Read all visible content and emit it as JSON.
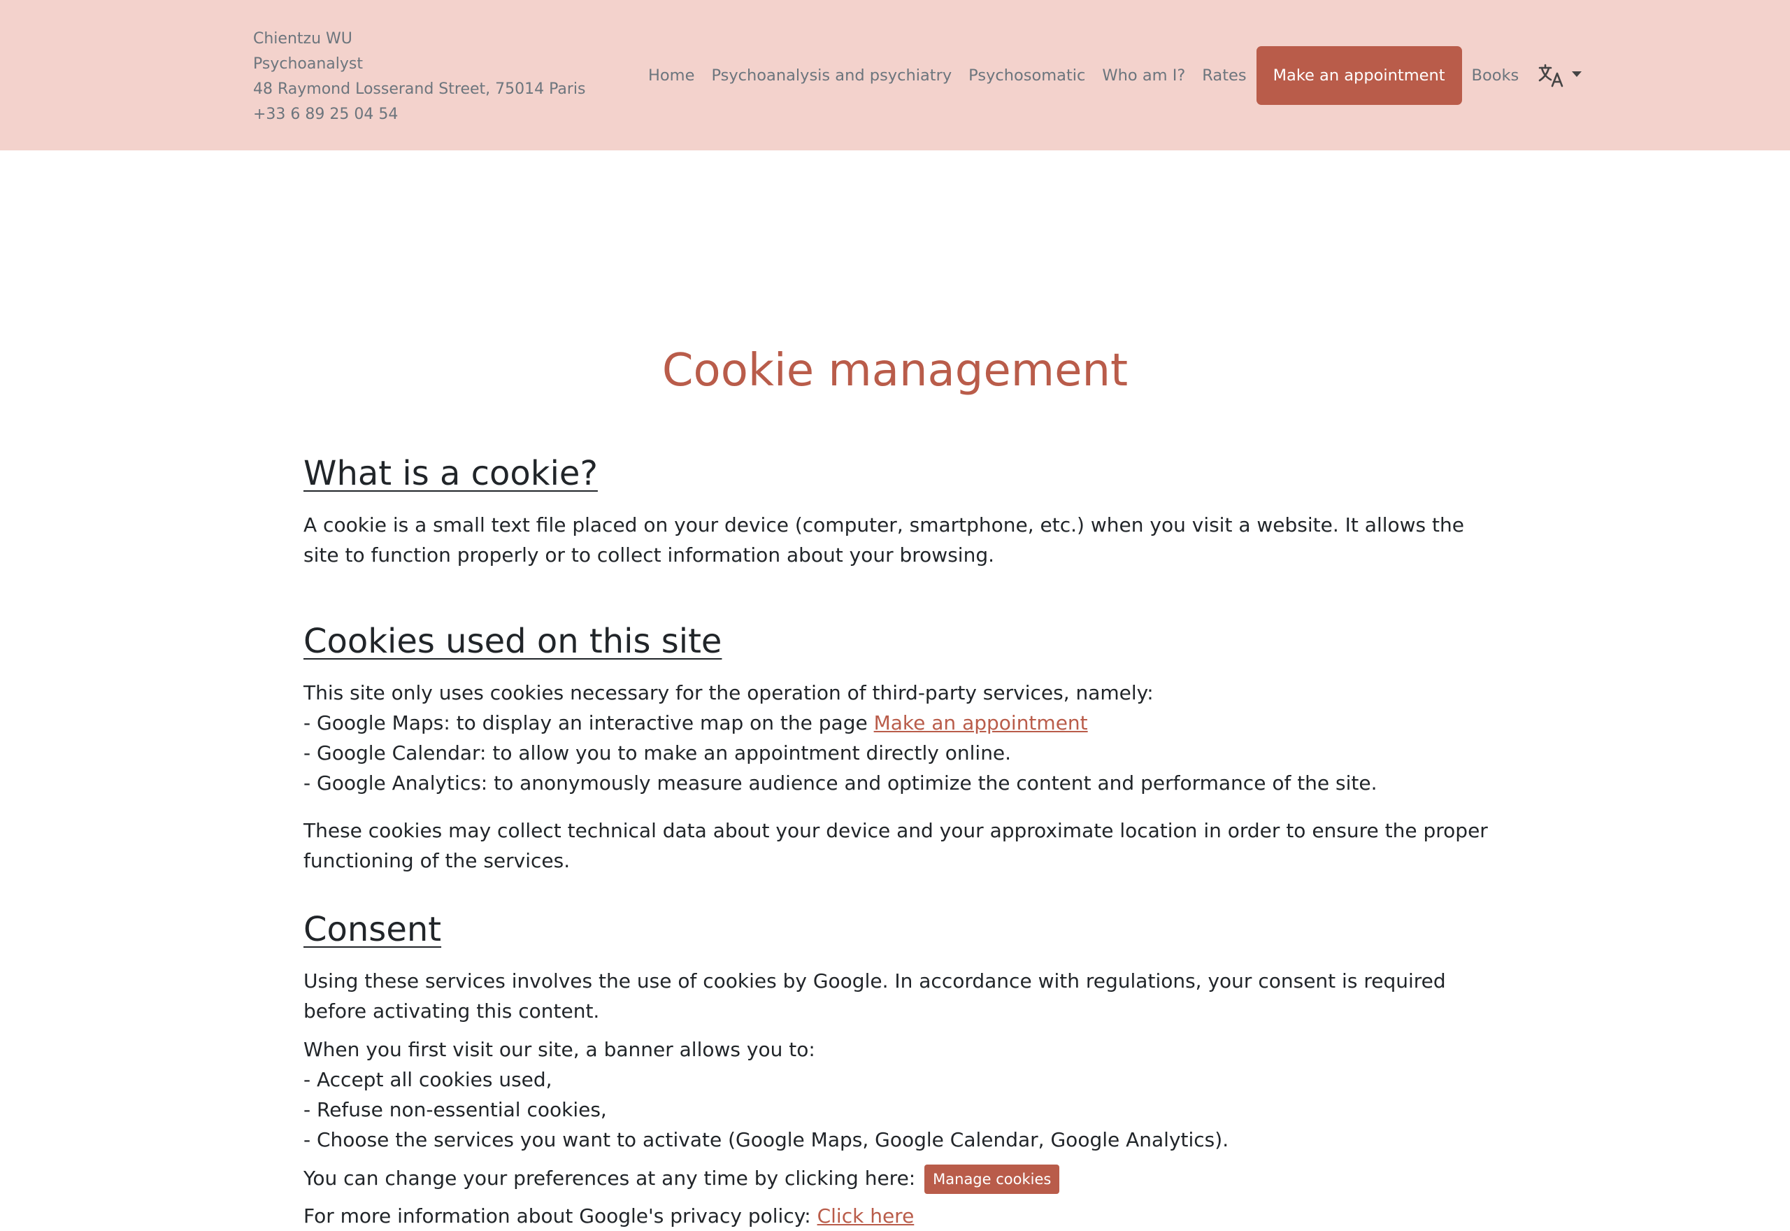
{
  "header": {
    "contact": {
      "name": "Chientzu WU",
      "role": "Psychoanalyst",
      "address": "48 Raymond Losserand Street, 75014 Paris",
      "phone": "+33 6 89 25 04 54"
    },
    "nav": {
      "home": "Home",
      "psychoanalysis": "Psychoanalysis and psychiatry",
      "psychosomatic": "Psychosomatic",
      "who": "Who am I?",
      "rates": "Rates",
      "appointment": "Make an appointment",
      "books": "Books",
      "language_icon": "translate-icon"
    }
  },
  "page": {
    "title": "Cookie management",
    "sections": {
      "what": {
        "heading": "What is a cookie?",
        "body": "A cookie is a small text file placed on your device (computer, smartphone, etc.) when you visit a website. It allows the site to function properly or to collect information about your browsing."
      },
      "used": {
        "heading": "Cookies used on this site",
        "intro": "This site only uses cookies necessary for the operation of third-party services, namely:",
        "maps_prefix": "- Google Maps: to display an interactive map on the page ",
        "maps_link": "Make an appointment",
        "calendar": "- Google Calendar: to allow you to make an appointment directly online.",
        "analytics": "- Google Analytics: to anonymously measure audience and optimize the content and performance of the site.",
        "data_note": "These cookies may collect technical data about your device and your approximate location in order to ensure the proper functioning of the services."
      },
      "consent": {
        "heading": "Consent",
        "body": "Using these services involves the use of cookies by Google. In accordance with regulations, your consent is required before activating this content.",
        "banner_intro": "When you first visit our site, a banner allows you to:",
        "option_accept": "- Accept all cookies used,",
        "option_refuse": "- Refuse non-essential cookies,",
        "option_choose": "- Choose the services you want to activate (Google Maps, Google Calendar, Google Analytics).",
        "change_prefix": "You can change your preferences at any time by clicking here:",
        "manage_button": "Manage cookies",
        "privacy_prefix": "For more information about Google's privacy policy: ",
        "privacy_link": "Click here"
      }
    }
  },
  "colors": {
    "header_bg": "#f3d2cc",
    "accent": "#b95c4a",
    "text": "#212529",
    "muted": "#6c757d"
  }
}
